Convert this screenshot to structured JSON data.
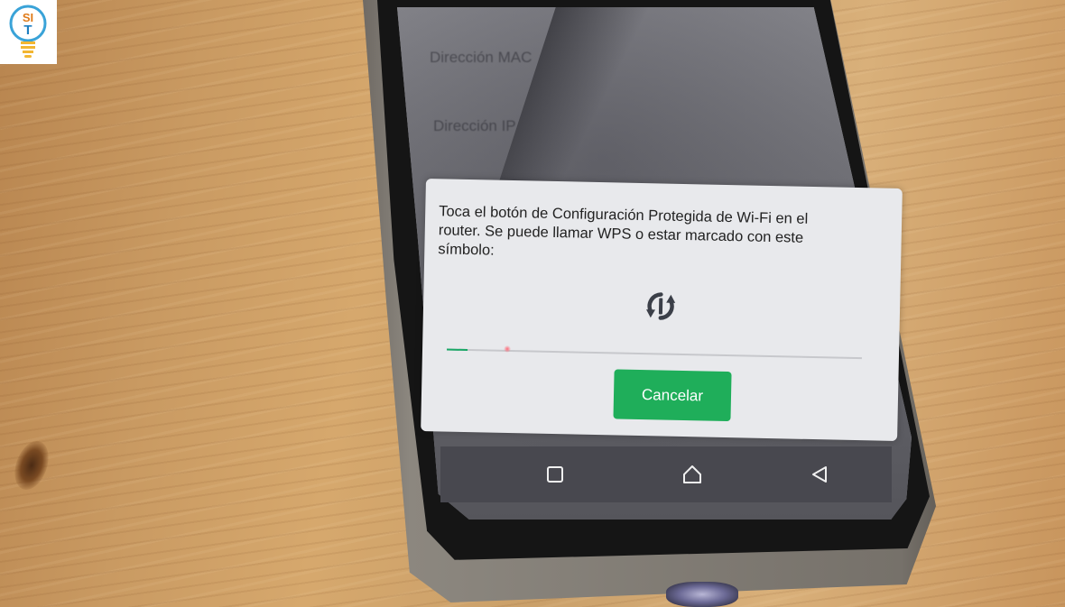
{
  "logo": {
    "letters": "SIT"
  },
  "background_screen": {
    "items": [
      {
        "label": "Dirección MAC",
        "value": ""
      },
      {
        "label": "Dirección IP",
        "value": ""
      }
    ]
  },
  "wps_dialog": {
    "message": "Toca el botón de Configuración Protegida de Wi-Fi en el router. Se puede llamar WPS o estar marcado con este símbolo:",
    "progress": 0.05,
    "cancel_label": "Cancelar",
    "icon": "wps-icon"
  },
  "nav_bar": {
    "buttons": [
      {
        "name": "recents-button",
        "icon": "square-icon"
      },
      {
        "name": "home-button",
        "icon": "home-icon"
      },
      {
        "name": "back-button",
        "icon": "back-triangle-icon"
      }
    ]
  },
  "colors": {
    "accent": "#1fae5a",
    "progress": "#19a766",
    "dialog_bg": "#e8e9ec",
    "nav_bg": "#48484f"
  }
}
